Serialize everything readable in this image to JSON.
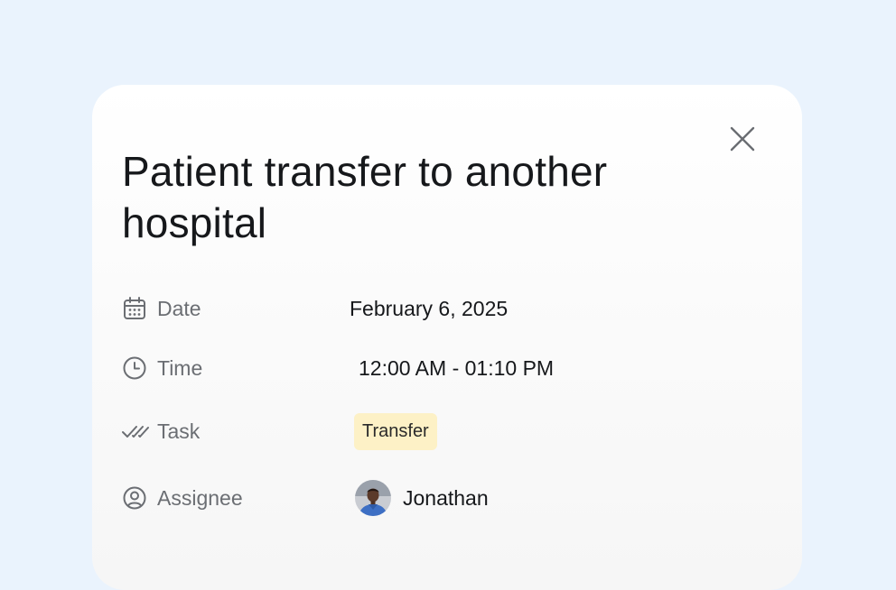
{
  "dialog": {
    "title": "Patient transfer to another hospital",
    "close_icon": "close-icon"
  },
  "fields": {
    "date": {
      "icon": "calendar-icon",
      "label": "Date",
      "value": "February 6, 2025"
    },
    "time": {
      "icon": "clock-icon",
      "label": "Time",
      "value": "12:00 AM - 01:10 PM"
    },
    "task": {
      "icon": "double-check-icon",
      "label": "Task",
      "value": "Transfer",
      "badge_color": "#fdf1c6"
    },
    "assignee": {
      "icon": "user-circle-icon",
      "label": "Assignee",
      "name": "Jonathan"
    }
  },
  "colors": {
    "page_background": "#eaf3fd",
    "card_background": "#ffffff",
    "title_text": "#16181b",
    "label_text": "#6b6e73"
  }
}
